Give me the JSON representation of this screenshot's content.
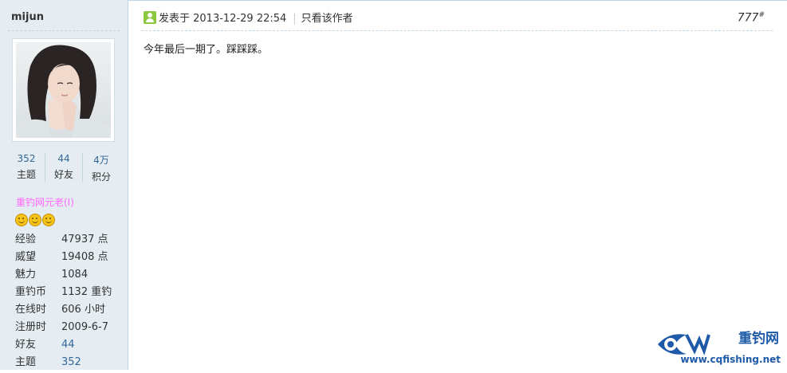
{
  "author": {
    "username": "mijun",
    "stats": [
      {
        "value": "352",
        "label": "主题"
      },
      {
        "value": "44",
        "label": "好友"
      },
      {
        "value": "4万",
        "label": "积分"
      }
    ],
    "group": "重钓网元老(I)",
    "stars_icon": "smiley-icon",
    "info": [
      {
        "key": "经验",
        "value": "47937 点"
      },
      {
        "key": "威望",
        "value": "19408 点"
      },
      {
        "key": "魅力",
        "value": "1084"
      },
      {
        "key": "重钓币",
        "value": "1132 重钓"
      },
      {
        "key": "在线时",
        "value": "606 小时"
      },
      {
        "key": "注册时",
        "value": "2009-6-7"
      },
      {
        "key": "好友",
        "value": "44"
      },
      {
        "key": "主题",
        "value": "352"
      }
    ]
  },
  "post": {
    "posted_at": "发表于 2013-12-29 22:54",
    "author_only": "只看该作者",
    "floor": "777",
    "floor_mark": "#",
    "content": "今年最后一期了。踩踩踩。"
  },
  "watermark": {
    "title": "重钓网",
    "url": "www.cqfishing.net"
  },
  "colors": {
    "sidebar_bg": "#e5edf2",
    "link": "#336699",
    "group": "#ff66ff",
    "brand": "#1e5aa8"
  }
}
